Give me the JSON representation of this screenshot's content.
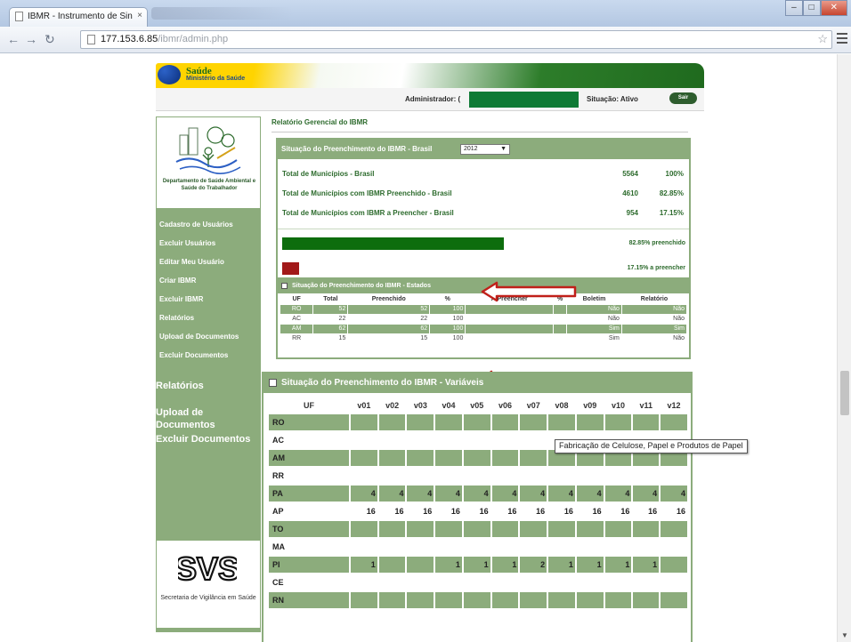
{
  "browser": {
    "tab_title": "IBMR - Instrumento de Sin",
    "tab_close": "×",
    "url_host": "177.153.6.85",
    "url_path": "/ibmr/admin.php",
    "window_buttons": [
      "–",
      "□",
      "✕"
    ]
  },
  "header": {
    "logo_title": "Saúde",
    "logo_subtitle": "Ministério da Saúde",
    "admin_label": "Administrador: (",
    "status_label": "Situação: Ativo",
    "exit_label": "Sair"
  },
  "sidebar": {
    "dept_name": "Departamento de Saúde Ambiental e Saúde do Trabalhador",
    "links_small": [
      "Cadastro de Usuários",
      "Excluir Usuários",
      "Editar Meu Usuário",
      "Criar IBMR",
      "Excluir IBMR",
      "Relatórios",
      "Upload de Documentos",
      "Excluir Documentos"
    ],
    "links_big": [
      "Relatórios",
      "Upload de Documentos",
      "Excluir Documentos"
    ],
    "svs_logo_text": "SVS",
    "svs_text": "Secretaria de Vigilância em Saúde"
  },
  "report": {
    "title": "Relatório Gerencial do IBMR",
    "brasil_panel_title": "Situação do Preenchimento do IBMR - Brasil",
    "year": "2012",
    "stats": [
      {
        "label": "Total de Municípios - Brasil",
        "count": "5564",
        "pct": "100%"
      },
      {
        "label": "Total de Municípios com IBMR Preenchido - Brasil",
        "count": "4610",
        "pct": "82.85%"
      },
      {
        "label": "Total de Municípios com IBMR a Preencher - Brasil",
        "count": "954",
        "pct": "17.15%"
      }
    ],
    "filled_fraction": 0.8285,
    "pending_fraction": 0.1715,
    "filled_label": "82.85% preenchido",
    "pending_label": "17.15% a preencher",
    "colors": {
      "filled": "#0d6d0d",
      "pending": "#a21919",
      "panel": "#8cac7c",
      "arrow": "#c0201a"
    }
  },
  "estados": {
    "title": "Situação do Preenchimento do IBMR - Estados",
    "headers": [
      "UF",
      "Total",
      "Preenchido",
      "%",
      "A Preencher",
      "%",
      "Boletim",
      "Relatório"
    ],
    "rows": [
      [
        "RO",
        "52",
        "52",
        "100",
        "",
        "",
        "Não",
        "Não"
      ],
      [
        "AC",
        "22",
        "22",
        "100",
        "",
        "",
        "Não",
        "Não"
      ],
      [
        "AM",
        "62",
        "62",
        "100",
        "",
        "",
        "Sim",
        "Sim"
      ],
      [
        "RR",
        "15",
        "15",
        "100",
        "",
        "",
        "Sim",
        "Não"
      ]
    ]
  },
  "variaveis": {
    "title": "Situação do Preenchimento do IBMR - Variáveis",
    "headers": [
      "UF",
      "v01",
      "v02",
      "v03",
      "v04",
      "v05",
      "v06",
      "v07",
      "v08",
      "v09",
      "v10",
      "v11",
      "v12"
    ],
    "rows": [
      [
        "RO",
        "",
        "",
        "",
        "",
        "",
        "",
        "",
        "",
        "",
        "",
        "",
        ""
      ],
      [
        "AC",
        "",
        "",
        "",
        "",
        "",
        "",
        "",
        "",
        "",
        "",
        "",
        ""
      ],
      [
        "AM",
        "",
        "",
        "",
        "",
        "",
        "",
        "",
        "",
        "",
        "",
        "",
        ""
      ],
      [
        "RR",
        "",
        "",
        "",
        "",
        "",
        "",
        "",
        "",
        "",
        "",
        "",
        ""
      ],
      [
        "PA",
        "4",
        "4",
        "4",
        "4",
        "4",
        "4",
        "4",
        "4",
        "4",
        "4",
        "4",
        "4"
      ],
      [
        "AP",
        "16",
        "16",
        "16",
        "16",
        "16",
        "16",
        "16",
        "16",
        "16",
        "16",
        "16",
        "16"
      ],
      [
        "TO",
        "",
        "",
        "",
        "",
        "",
        "",
        "",
        "",
        "",
        "",
        "",
        ""
      ],
      [
        "MA",
        "",
        "",
        "",
        "",
        "",
        "",
        "",
        "",
        "",
        "",
        "",
        ""
      ],
      [
        "PI",
        "1",
        "",
        "",
        "1",
        "1",
        "1",
        "2",
        "1",
        "1",
        "1",
        "1",
        ""
      ],
      [
        "CE",
        "",
        "",
        "",
        "",
        "",
        "",
        "",
        "",
        "",
        "",
        "",
        ""
      ],
      [
        "RN",
        "",
        "",
        "",
        "",
        "",
        "",
        "",
        "",
        "",
        "",
        "",
        ""
      ]
    ],
    "tooltip": "Fabricação de Celulose, Papel e Produtos de Papel"
  }
}
